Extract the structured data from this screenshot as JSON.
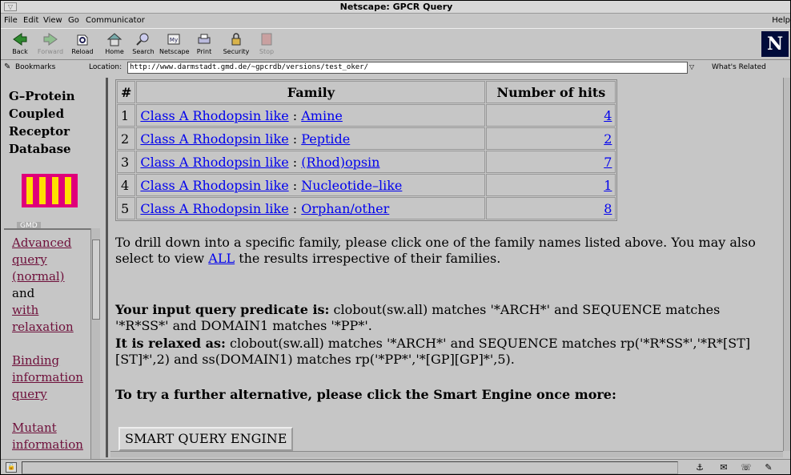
{
  "window": {
    "title": "Netscape: GPCR Query"
  },
  "menu": {
    "items": [
      "File",
      "Edit",
      "View",
      "Go",
      "Communicator"
    ],
    "help": "Help"
  },
  "toolbar": {
    "buttons": [
      {
        "label": "Back",
        "icon": "back-arrow-icon"
      },
      {
        "label": "Forward",
        "icon": "forward-arrow-icon"
      },
      {
        "label": "Reload",
        "icon": "reload-icon"
      },
      {
        "label": "Home",
        "icon": "home-icon"
      },
      {
        "label": "Search",
        "icon": "search-icon"
      },
      {
        "label": "Netscape",
        "icon": "netscape-icon"
      },
      {
        "label": "Print",
        "icon": "print-icon"
      },
      {
        "label": "Security",
        "icon": "security-lock-icon"
      },
      {
        "label": "Stop",
        "icon": "stop-icon"
      }
    ],
    "logo": "N"
  },
  "location": {
    "bookmarks_label": "Bookmarks",
    "label": "Location:",
    "url": "http://www.darmstadt.gmd.de/~gpcrdb/versions/test_oker/",
    "related_label": "What's Related"
  },
  "sidebar": {
    "title": "G–Protein\nCoupled\nReceptor\nDatabase",
    "gmd_label": "GMD",
    "links": [
      {
        "text": "Advanced\nquery\n(normal)",
        "link": true
      },
      {
        "text": "and",
        "link": false
      },
      {
        "text": "with\nrelaxation",
        "link": true
      },
      {
        "text": "Binding\ninformation\nquery",
        "link": true
      },
      {
        "text": "Mutant\ninformation",
        "link": true
      }
    ]
  },
  "results": {
    "headers": [
      "#",
      "Family",
      "Number of hits"
    ],
    "rows": [
      {
        "n": "1",
        "class": "Class A Rhodopsin like",
        "sub": "Amine",
        "hits": "4"
      },
      {
        "n": "2",
        "class": "Class A Rhodopsin like",
        "sub": "Peptide",
        "hits": "2"
      },
      {
        "n": "3",
        "class": "Class A Rhodopsin like",
        "sub": "(Rhod)opsin",
        "hits": "7"
      },
      {
        "n": "4",
        "class": "Class A Rhodopsin like",
        "sub": "Nucleotide–like",
        "hits": "1"
      },
      {
        "n": "5",
        "class": "Class A Rhodopsin like",
        "sub": "Orphan/other",
        "hits": "8"
      }
    ],
    "separator": " : "
  },
  "info": {
    "drill_before": "To drill down into a specific family, please click one of the family names listed above. You may also select to view ",
    "drill_link": "ALL",
    "drill_after": " the results irrespective of their families.",
    "predicate_label": "Your input query predicate is:",
    "predicate_text": " clobout(sw.all) matches '*ARCH*' and SEQUENCE matches '*R*SS*' and DOMAIN1 matches '*PP*'.",
    "relaxed_label": "It is relaxed as:",
    "relaxed_text": " clobout(sw.all) matches '*ARCH*' and SEQUENCE matches rp('*R*SS*','*R*[ST][ST]*',2) and ss(DOMAIN1) matches rp('*PP*','*[GP][GP]*',5).",
    "further": "To try a further alternative, please click the Smart Engine once more:",
    "button": "SMART QUERY ENGINE"
  }
}
